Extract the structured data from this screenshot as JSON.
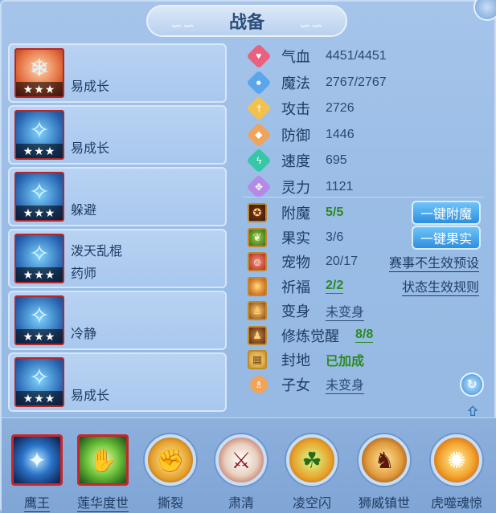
{
  "title": "战备",
  "skill_cards": [
    {
      "text1": "",
      "text2": "易成长",
      "stars": "★★★",
      "icon": "popsicle-icon"
    },
    {
      "text1": "",
      "text2": "易成长",
      "stars": "★★★",
      "icon": "pet-icon"
    },
    {
      "text1": "",
      "text2": "躲避",
      "stars": "★★★",
      "icon": "pet-icon"
    },
    {
      "text1": "泼天乱棍",
      "text2": "药师",
      "stars": "★★★",
      "icon": "pet-icon"
    },
    {
      "text1": "",
      "text2": "冷静",
      "stars": "★★★",
      "icon": "pet-icon"
    },
    {
      "text1": "",
      "text2": "易成长",
      "stars": "★★★",
      "icon": "pet-icon"
    }
  ],
  "stats": [
    {
      "label": "气血",
      "value": "4451/4451",
      "icon": "heart-icon",
      "color": "#e9617e"
    },
    {
      "label": "魔法",
      "value": "2767/2767",
      "icon": "magic-icon",
      "color": "#5aa6ec"
    },
    {
      "label": "攻击",
      "value": "2726",
      "icon": "sword-icon",
      "color": "#f2c14e"
    },
    {
      "label": "防御",
      "value": "1446",
      "icon": "shield-icon",
      "color": "#f0a35a"
    },
    {
      "label": "速度",
      "value": "695",
      "icon": "lightning-icon",
      "color": "#36c8a6"
    },
    {
      "label": "灵力",
      "value": "1121",
      "icon": "spirit-icon",
      "color": "#b38be6"
    }
  ],
  "attrs": [
    {
      "label": "附魔",
      "value": "5/5",
      "style": "green-plain",
      "icon": "enchant-icon"
    },
    {
      "label": "果实",
      "value": "3/6",
      "style": "plain",
      "icon": "fruit-icon"
    },
    {
      "label": "宠物",
      "value": "20/17",
      "style": "plain",
      "icon": "pet-portrait-icon"
    },
    {
      "label": "祈福",
      "value": "2/2",
      "style": "green",
      "icon": "bless-icon"
    },
    {
      "label": "变身",
      "value": "未变身",
      "style": "underline",
      "icon": "transform-icon"
    },
    {
      "label": "修炼觉醒",
      "value": "8/8",
      "style": "green",
      "icon": "cultivate-icon"
    },
    {
      "label": "封地",
      "value": "已加成",
      "style": "green-bold",
      "icon": "fief-icon"
    },
    {
      "label": "子女",
      "value": "未变身",
      "style": "underline",
      "icon": "child-icon"
    }
  ],
  "buttons": {
    "enchant_all": "一键附魔",
    "fruit_all": "一键果实",
    "link_event": "赛事不生效预设",
    "link_rules": "状态生效规则"
  },
  "bottom_skills": [
    {
      "name": "鹰王",
      "style": "framed",
      "underline": true,
      "glyph": "✦"
    },
    {
      "name": "莲华度世",
      "style": "framed",
      "underline": true,
      "glyph": "✋"
    },
    {
      "name": "撕裂",
      "style": "round",
      "underline": false,
      "glyph": "✊"
    },
    {
      "name": "肃清",
      "style": "round",
      "underline": false,
      "glyph": "⚔"
    },
    {
      "name": "凌空闪",
      "style": "round",
      "underline": false,
      "glyph": "☘"
    },
    {
      "name": "狮威镇世",
      "style": "round",
      "underline": false,
      "glyph": "♞"
    },
    {
      "name": "虎噬魂惊",
      "style": "round",
      "underline": false,
      "glyph": "✺"
    }
  ]
}
